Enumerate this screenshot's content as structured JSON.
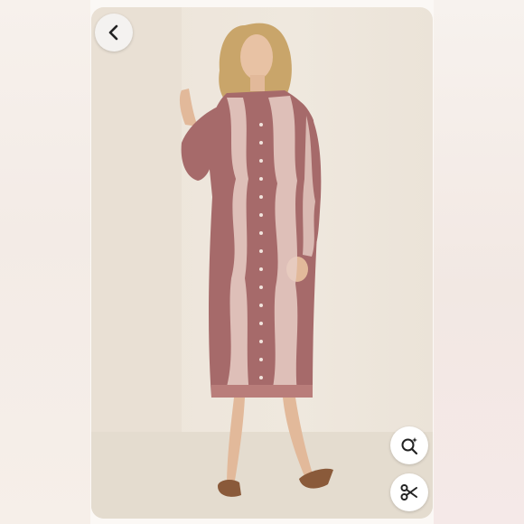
{
  "viewer": {
    "buttons": {
      "back": {
        "icon": "chevron-left-icon"
      },
      "visual_search": {
        "icon": "lens-search-icon"
      },
      "crop": {
        "icon": "scissors-icon"
      }
    }
  },
  "product_photo": {
    "dress_color": "#a66a6a",
    "embroidery_color": "#f1dfd8",
    "background_color": "#ede6dc"
  }
}
